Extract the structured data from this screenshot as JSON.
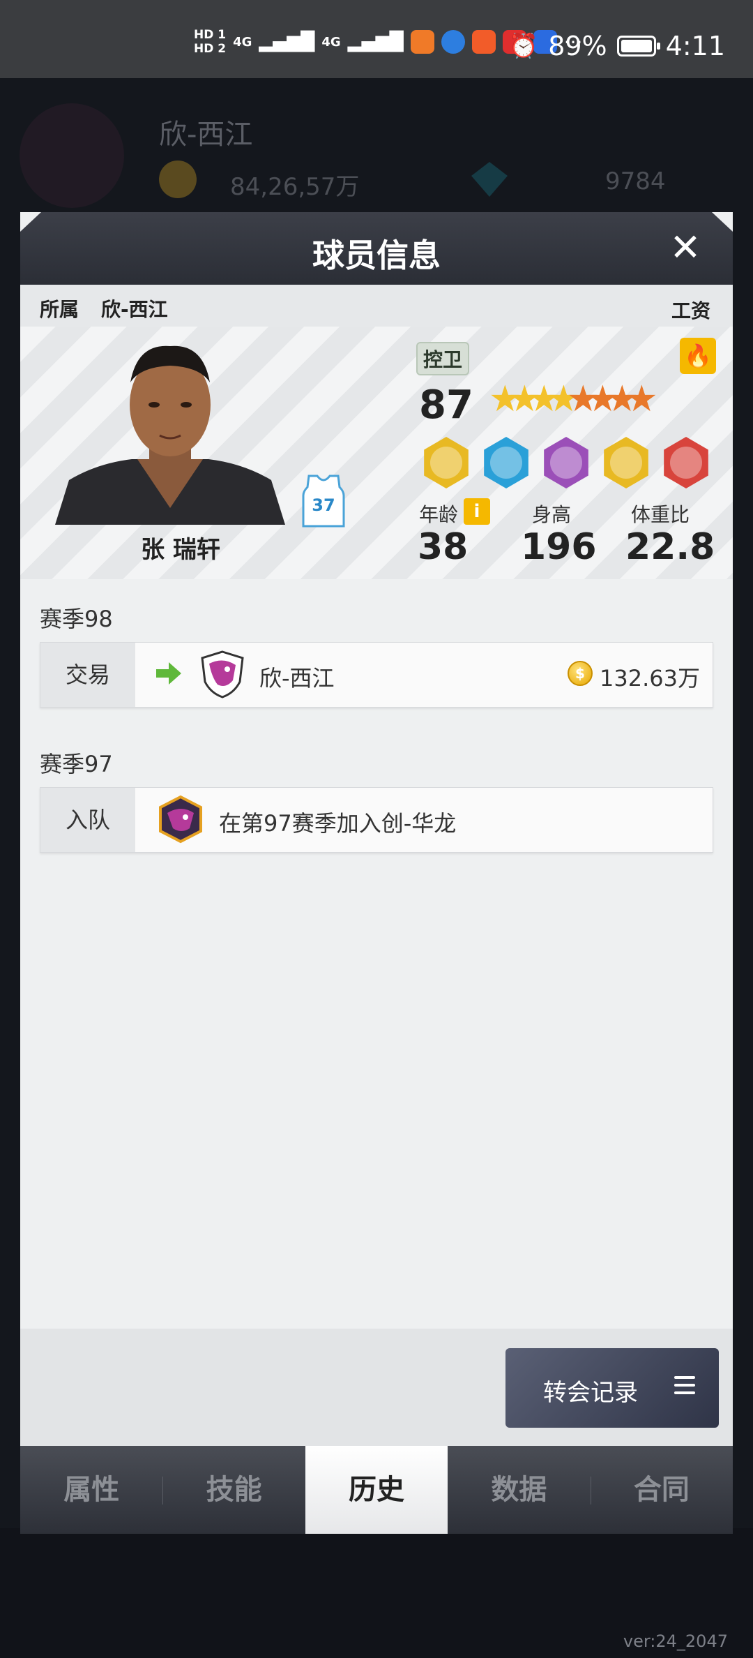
{
  "status_bar": {
    "sim1": "HD 1",
    "sim2": "HD 2",
    "network1": "4G",
    "network2": "4G",
    "battery_percent": "89%",
    "time": "4:11",
    "more": "···"
  },
  "background": {
    "team_name": "欣-西江",
    "coins": "84,26,57万",
    "gems": "9784",
    "version": "ver:24_2047"
  },
  "modal": {
    "title": "球员信息",
    "close_label": "✕",
    "affiliation_label": "所属",
    "affiliation_value": "欣-西江",
    "salary_label": "工资"
  },
  "player": {
    "name": "张 瑞轩",
    "jersey_number": "37",
    "position": "控卫",
    "rating": "87",
    "stars_total": 8,
    "stars_gold": 4,
    "age_label": "年龄",
    "age": "38",
    "height_label": "身高",
    "height": "196",
    "weight_ratio_label": "体重比",
    "weight_ratio": "22.8",
    "badges": [
      {
        "name": "gold-player-badge",
        "color": "#e8b923"
      },
      {
        "name": "lightning-badge",
        "color": "#2aa0d8"
      },
      {
        "name": "purple-player-badge",
        "color": "#9b4fb8"
      },
      {
        "name": "winged-badge",
        "color": "#e8b923"
      },
      {
        "name": "red-player-badge",
        "color": "#d8443c"
      }
    ]
  },
  "history": [
    {
      "season": "赛季98",
      "event_type": "交易",
      "team": "欣-西江",
      "amount": "132.63万"
    },
    {
      "season": "赛季97",
      "event_type": "入队",
      "description": "在第97赛季加入创-华龙"
    }
  ],
  "transfer_button": "转会记录",
  "tabs": [
    {
      "label": "属性",
      "active": false
    },
    {
      "label": "技能",
      "active": false
    },
    {
      "label": "历史",
      "active": true
    },
    {
      "label": "数据",
      "active": false
    },
    {
      "label": "合同",
      "active": false
    }
  ],
  "colors": {
    "accent_gold": "#f5b800",
    "header_dark": "#2b2e36",
    "arrow_green": "#5fb83a"
  }
}
